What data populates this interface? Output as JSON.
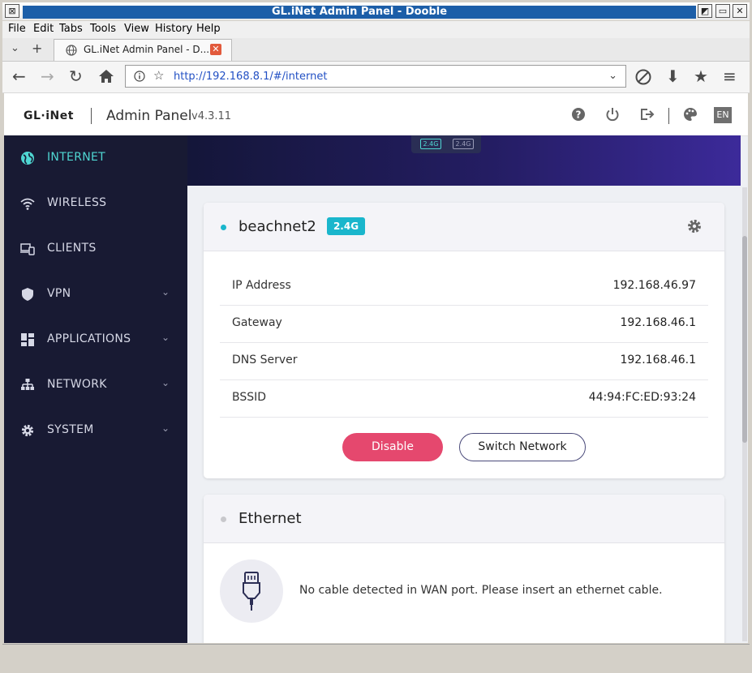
{
  "window": {
    "title": "GL.iNet Admin Panel - Dooble"
  },
  "menu": [
    "File",
    "Edit",
    "Tabs",
    "Tools",
    "View",
    "History",
    "Help"
  ],
  "tabs": [
    {
      "label": "GL.iNet Admin Panel - D..."
    }
  ],
  "address": {
    "url": "http://192.168.8.1/#/internet"
  },
  "app": {
    "logo": "GL·iNet",
    "title": "Admin Panel",
    "version": "v4.3.11",
    "language": "EN"
  },
  "sidebar": {
    "items": [
      {
        "label": "INTERNET",
        "active": true
      },
      {
        "label": "WIRELESS"
      },
      {
        "label": "CLIENTS"
      },
      {
        "label": "VPN",
        "expandable": true
      },
      {
        "label": "APPLICATIONS",
        "expandable": true
      },
      {
        "label": "NETWORK",
        "expandable": true
      },
      {
        "label": "SYSTEM",
        "expandable": true
      }
    ]
  },
  "banner": {
    "band_a": "2.4G",
    "band_b": "2.4G"
  },
  "wifi_card": {
    "ssid": "beachnet2",
    "band": "2.4G",
    "rows": [
      {
        "label": "IP Address",
        "value": "192.168.46.97"
      },
      {
        "label": "Gateway",
        "value": "192.168.46.1"
      },
      {
        "label": "DNS Server",
        "value": "192.168.46.1"
      },
      {
        "label": "BSSID",
        "value": "44:94:FC:ED:93:24"
      }
    ],
    "disable_label": "Disable",
    "switch_label": "Switch Network"
  },
  "ethernet_card": {
    "title": "Ethernet",
    "message": "No cable detected in WAN port. Please insert an ethernet cable."
  },
  "colors": {
    "accent": "#4fd6d2",
    "sidebar_bg": "#181a33",
    "danger": "#e5486e",
    "badge": "#1ab6cc"
  }
}
